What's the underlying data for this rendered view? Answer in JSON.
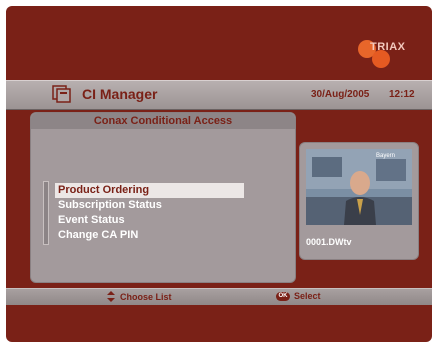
{
  "brand": {
    "logo_text": "TRIAX"
  },
  "header": {
    "title": "CI Manager",
    "date": "30/Aug/2005",
    "time": "12:12"
  },
  "panel": {
    "title": "Conax Conditional Access",
    "menu": [
      {
        "label": "Product Ordering",
        "selected": true
      },
      {
        "label": "Subscription Status",
        "selected": false
      },
      {
        "label": "Event Status",
        "selected": false
      },
      {
        "label": "Change CA PIN",
        "selected": false
      }
    ]
  },
  "preview": {
    "channel": "0001.DWtv",
    "overlay_text": "Bayern"
  },
  "footer": {
    "choose_label": "Choose List",
    "select_label": "Select",
    "ok_badge": "OK"
  },
  "colors": {
    "background": "#7a2117",
    "panel": "#a39a9c",
    "highlight": "#ece7e6",
    "accent": "#e8662a"
  }
}
